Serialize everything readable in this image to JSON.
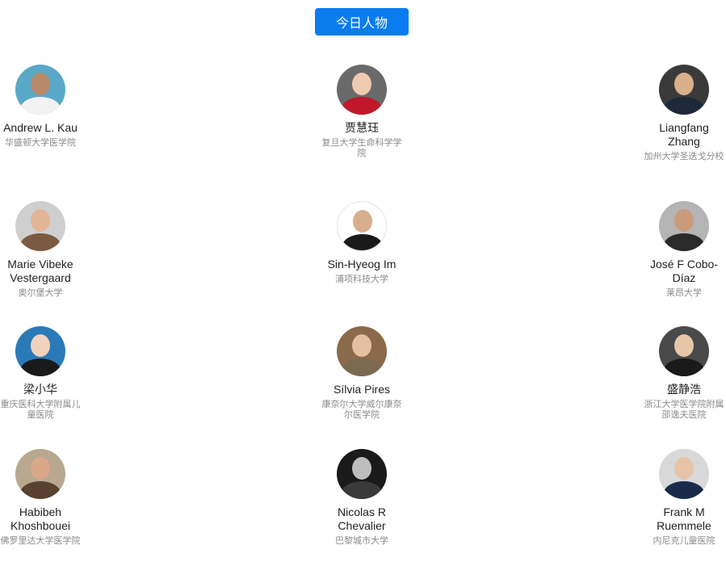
{
  "header": {
    "title": "今日人物"
  },
  "people": [
    {
      "name": "Andrew L. Kau",
      "org": "华盛顿大学医学院",
      "bg": "#5aa8c8",
      "skin": "#b88a6a",
      "shirt": "#f2f2f2"
    },
    {
      "name": "贾慧珏",
      "org": "复旦大学生命科学学院",
      "bg": "#6a6a6a",
      "skin": "#efc9b0",
      "shirt": "#c0182a"
    },
    {
      "name": "Liangfang Zhang",
      "org": "加州大学圣迭戈分校",
      "bg": "#3a3a3a",
      "skin": "#d9b08c",
      "shirt": "#1e2a3a"
    },
    {
      "name": "Marie Vibeke Vestergaard",
      "org": "奥尔堡大学",
      "bg": "#cfcfcf",
      "skin": "#e2b596",
      "shirt": "#7a5a40"
    },
    {
      "name": "Sin-Hyeog Im",
      "org": "浦项科技大学",
      "bg": "#ffffff",
      "skin": "#d7ae8e",
      "shirt": "#1a1a1a"
    },
    {
      "name": "José F Cobo-Díaz",
      "org": "莱昂大学",
      "bg": "#b4b4b4",
      "skin": "#c99b7a",
      "shirt": "#2a2a2a"
    },
    {
      "name": "梁小华",
      "org": "重庆医科大学附属儿童医院",
      "bg": "#2a7ab8",
      "skin": "#f0d2bd",
      "shirt": "#1a1a1a"
    },
    {
      "name": "Sílvia Pires",
      "org": "康奈尔大学威尔康奈尔医学院",
      "bg": "#8a6a4a",
      "skin": "#e5bfa2",
      "shirt": "#7a6a50"
    },
    {
      "name": "盛静浩",
      "org": "浙江大学医学院附属邵逸夫医院",
      "bg": "#4a4a4a",
      "skin": "#e8c6aa",
      "shirt": "#1a1a1a"
    },
    {
      "name": "Habibeh Khoshbouei",
      "org": "佛罗里达大学医学院",
      "bg": "#b8a890",
      "skin": "#d9a888",
      "shirt": "#5a4030"
    },
    {
      "name": "Nicolas R Chevalier",
      "org": "巴黎城市大学",
      "bg": "#1a1a1a",
      "skin": "#bdbdbd",
      "shirt": "#3a3a3a"
    },
    {
      "name": "Frank M Ruemmele",
      "org": "内尼克儿童医院",
      "bg": "#d8d8d8",
      "skin": "#e6c4a8",
      "shirt": "#1a2a4a"
    }
  ]
}
